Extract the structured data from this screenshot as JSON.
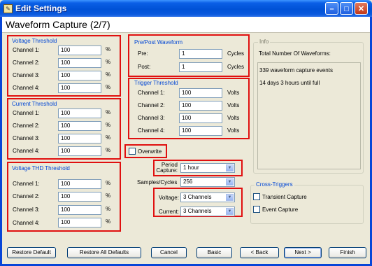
{
  "window": {
    "title": "Edit Settings"
  },
  "header": {
    "title": "Waveform Capture (2/7)"
  },
  "voltage_threshold": {
    "title": "Voltage Threshold",
    "channels": [
      {
        "label": "Channel 1:",
        "value": "100",
        "unit": "%"
      },
      {
        "label": "Channel 2:",
        "value": "100",
        "unit": "%"
      },
      {
        "label": "Channel 3:",
        "value": "100",
        "unit": "%"
      },
      {
        "label": "Channel 4:",
        "value": "100",
        "unit": "%"
      }
    ]
  },
  "current_threshold": {
    "title": "Current Threshold",
    "channels": [
      {
        "label": "Channel 1:",
        "value": "100",
        "unit": "%"
      },
      {
        "label": "Channel 2:",
        "value": "100",
        "unit": "%"
      },
      {
        "label": "Channel 3:",
        "value": "100",
        "unit": "%"
      },
      {
        "label": "Channel 4:",
        "value": "100",
        "unit": "%"
      }
    ]
  },
  "voltage_thd_threshold": {
    "title": "Voltage THD Threshold",
    "channels": [
      {
        "label": "Channel 1:",
        "value": "100",
        "unit": "%"
      },
      {
        "label": "Channel 2:",
        "value": "100",
        "unit": "%"
      },
      {
        "label": "Channel 3:",
        "value": "100",
        "unit": "%"
      },
      {
        "label": "Channel 4:",
        "value": "100",
        "unit": "%"
      }
    ]
  },
  "pre_post": {
    "title": "Pre/Post Waveform",
    "rows": [
      {
        "label": "Pre:",
        "value": "1",
        "unit": "Cycles"
      },
      {
        "label": "Post:",
        "value": "1",
        "unit": "Cycles"
      }
    ]
  },
  "trigger_threshold": {
    "title": "Trigger Threshold",
    "channels": [
      {
        "label": "Channel 1:",
        "value": "100",
        "unit": "Volts"
      },
      {
        "label": "Channel 2:",
        "value": "100",
        "unit": "Volts"
      },
      {
        "label": "Channel 3:",
        "value": "100",
        "unit": "Volts"
      },
      {
        "label": "Channel 4:",
        "value": "100",
        "unit": "Volts"
      }
    ]
  },
  "overwrite": {
    "label": "Overwrite",
    "checked": false
  },
  "period_capture": {
    "label": "Period Capture:",
    "value": "1 hour"
  },
  "samples_cycles": {
    "label": "Samples/Cycles",
    "value": "256"
  },
  "voltage": {
    "label": "Voltage:",
    "value": "3 Channels"
  },
  "current": {
    "label": "Current:",
    "value": "3 Channels"
  },
  "info": {
    "title": "Info",
    "total_label": "Total Number Of Waveforms:",
    "lines": [
      "339 waveform capture events",
      "14 days 3 hours until full"
    ]
  },
  "cross_triggers": {
    "title": "Cross-Triggers",
    "items": [
      {
        "label": "Transient Capture",
        "checked": false
      },
      {
        "label": "Event Capture",
        "checked": false
      }
    ]
  },
  "buttons": {
    "restore_default": "Restore Default",
    "restore_all": "Restore All Defaults",
    "cancel": "Cancel",
    "basic": "Basic",
    "back": "< Back",
    "next": "Next >",
    "finish": "Finish"
  },
  "colors": {
    "title_bar": "#0052d6",
    "highlight_box": "#e01010",
    "group_title": "#0046d5"
  }
}
